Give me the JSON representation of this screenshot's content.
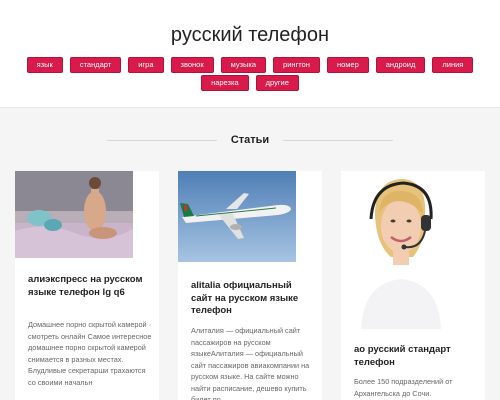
{
  "site": {
    "title": "русский телефон"
  },
  "tags": [
    "язык",
    "стандарт",
    "игра",
    "звонок",
    "музыка",
    "рингтон",
    "номер",
    "андроид",
    "линия",
    "нарезка",
    "другие"
  ],
  "section": {
    "title": "Статьи"
  },
  "articles": [
    {
      "title": "алиэкспресс на русском языке телефон lg q6",
      "excerpt": "Домашнее порно скрытой камерой · смотреть онлайн Самое интересное домашнее порно скрытой камерой снимается в разных местах. Блудливые секретарши трахаются со своими начальн"
    },
    {
      "title": "alitalia официальный сайт на русском языке телефон",
      "excerpt": "Алиталия — официальный сайт пассажиров на русском языкеАлиталия — официальный сайт пассажиров авиакомпании на русском языке. На сайте можно найти расписание, дешево купить билет по"
    },
    {
      "title": "ао русский стандарт телефон",
      "excerpt": "Более 150 подразделений от Архангельска до Сочи."
    }
  ],
  "colors": {
    "accent": "#d81b4a",
    "background": "#f5f5f5"
  }
}
